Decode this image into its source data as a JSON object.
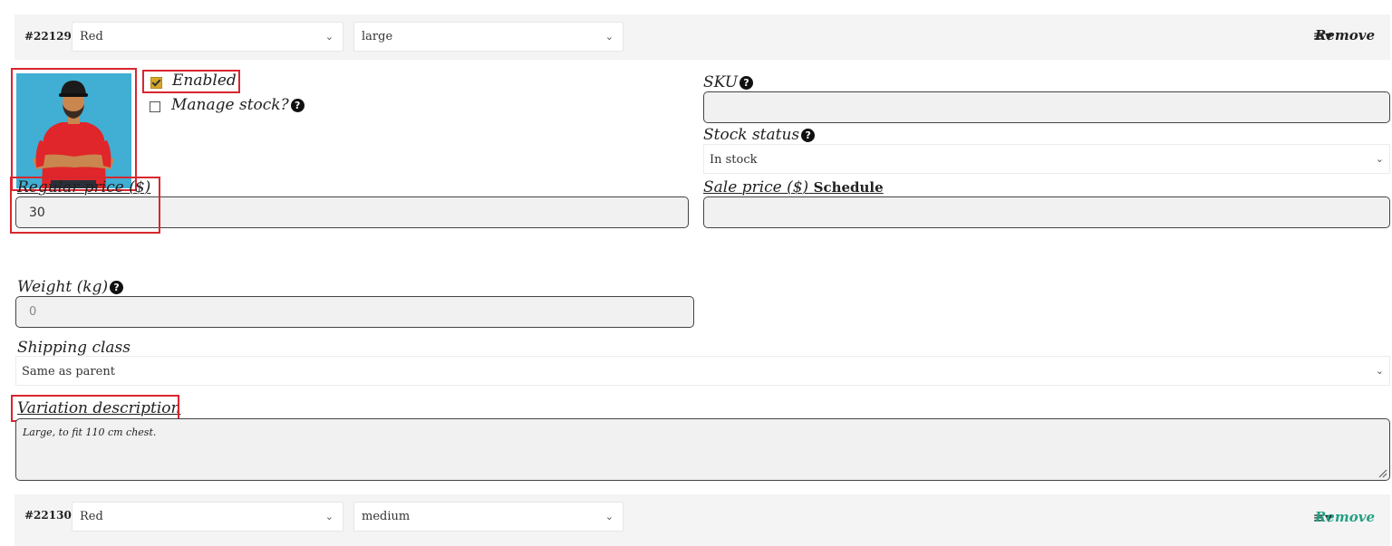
{
  "variations": [
    {
      "id": "#22129",
      "color": "Red",
      "size": "large",
      "remove_label": "Remove"
    },
    {
      "id": "#22130",
      "color": "Red",
      "size": "medium",
      "remove_label": "Remove"
    }
  ],
  "detail": {
    "enabled_label": "Enabled",
    "enabled_checked": true,
    "manage_stock_label": "Manage stock?",
    "manage_stock_checked": false,
    "sku_label": "SKU",
    "sku_value": "",
    "stock_status_label": "Stock status",
    "stock_status_value": "In stock",
    "regular_price_label": "Regular price ($)",
    "regular_price_value": "30",
    "sale_price_label": "Sale price ($)",
    "schedule_label": "Schedule",
    "sale_price_value": "",
    "weight_label": "Weight (kg)",
    "weight_placeholder": "0",
    "shipping_class_label": "Shipping class",
    "shipping_class_value": "Same as parent",
    "description_label": "Variation description",
    "description_value": "Large, to fit 110 cm chest."
  },
  "icons": {
    "help": "?",
    "menu": "≡▾",
    "chevron": "⌄"
  },
  "colors": {
    "highlight_border": "#d9262e",
    "remove_link_active": "#23a083",
    "checkbox_fill": "#d4a62a"
  }
}
